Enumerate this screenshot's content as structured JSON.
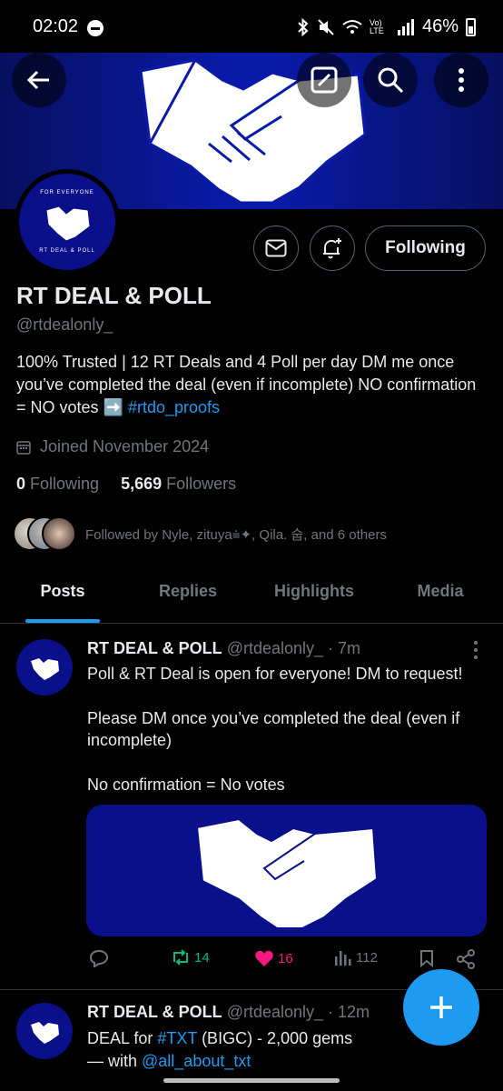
{
  "status": {
    "time": "02:02",
    "battery": "46%",
    "network": "Vo) LTE"
  },
  "profile": {
    "name": "RT DEAL & POLL",
    "handle": "@rtdealonly_",
    "avatar_top_text": "FOR EVERYONE",
    "avatar_bottom_text": "RT DEAL & POLL",
    "bio_text": "100% Trusted | 12 RT Deals and 4 Poll per day  DM me once you’ve completed the deal (even if incomplete)  NO confirmation = NO votes  ➡️ ",
    "bio_link": "#rtdo_proofs",
    "joined": "Joined November 2024",
    "following_count": "0",
    "following_label": "Following",
    "followers_count": "5,669",
    "followers_label": "Followers",
    "followed_by": "Followed by Nyle, zituya⩧✦, Qila. 숩, and 6 others",
    "follow_button": "Following"
  },
  "tabs": [
    "Posts",
    "Replies",
    "Highlights",
    "Media"
  ],
  "posts": [
    {
      "name": "RT DEAL & POLL",
      "meta": "@rtdealonly_ · 7m",
      "text_line1": "Poll & RT Deal is open for everyone! DM to request!",
      "text_line2": "Please DM once you’ve completed the deal (even if incomplete)",
      "text_line3": "No confirmation = No votes",
      "retweets": "14",
      "likes": "16",
      "views": "112"
    },
    {
      "name": "RT DEAL & POLL",
      "meta": "@rtdealonly_ · 12m",
      "text_prefix": "DEAL for ",
      "hashtag": "#TXT",
      "text_mid": " (BIGC) - 2,000 gems",
      "text_with": "— with ",
      "mention": "@all_about_txt"
    }
  ],
  "colors": {
    "accent": "#1d9bf0",
    "banner": "#0a1aa8",
    "like": "#f91880",
    "retweet": "#00ba7c"
  }
}
